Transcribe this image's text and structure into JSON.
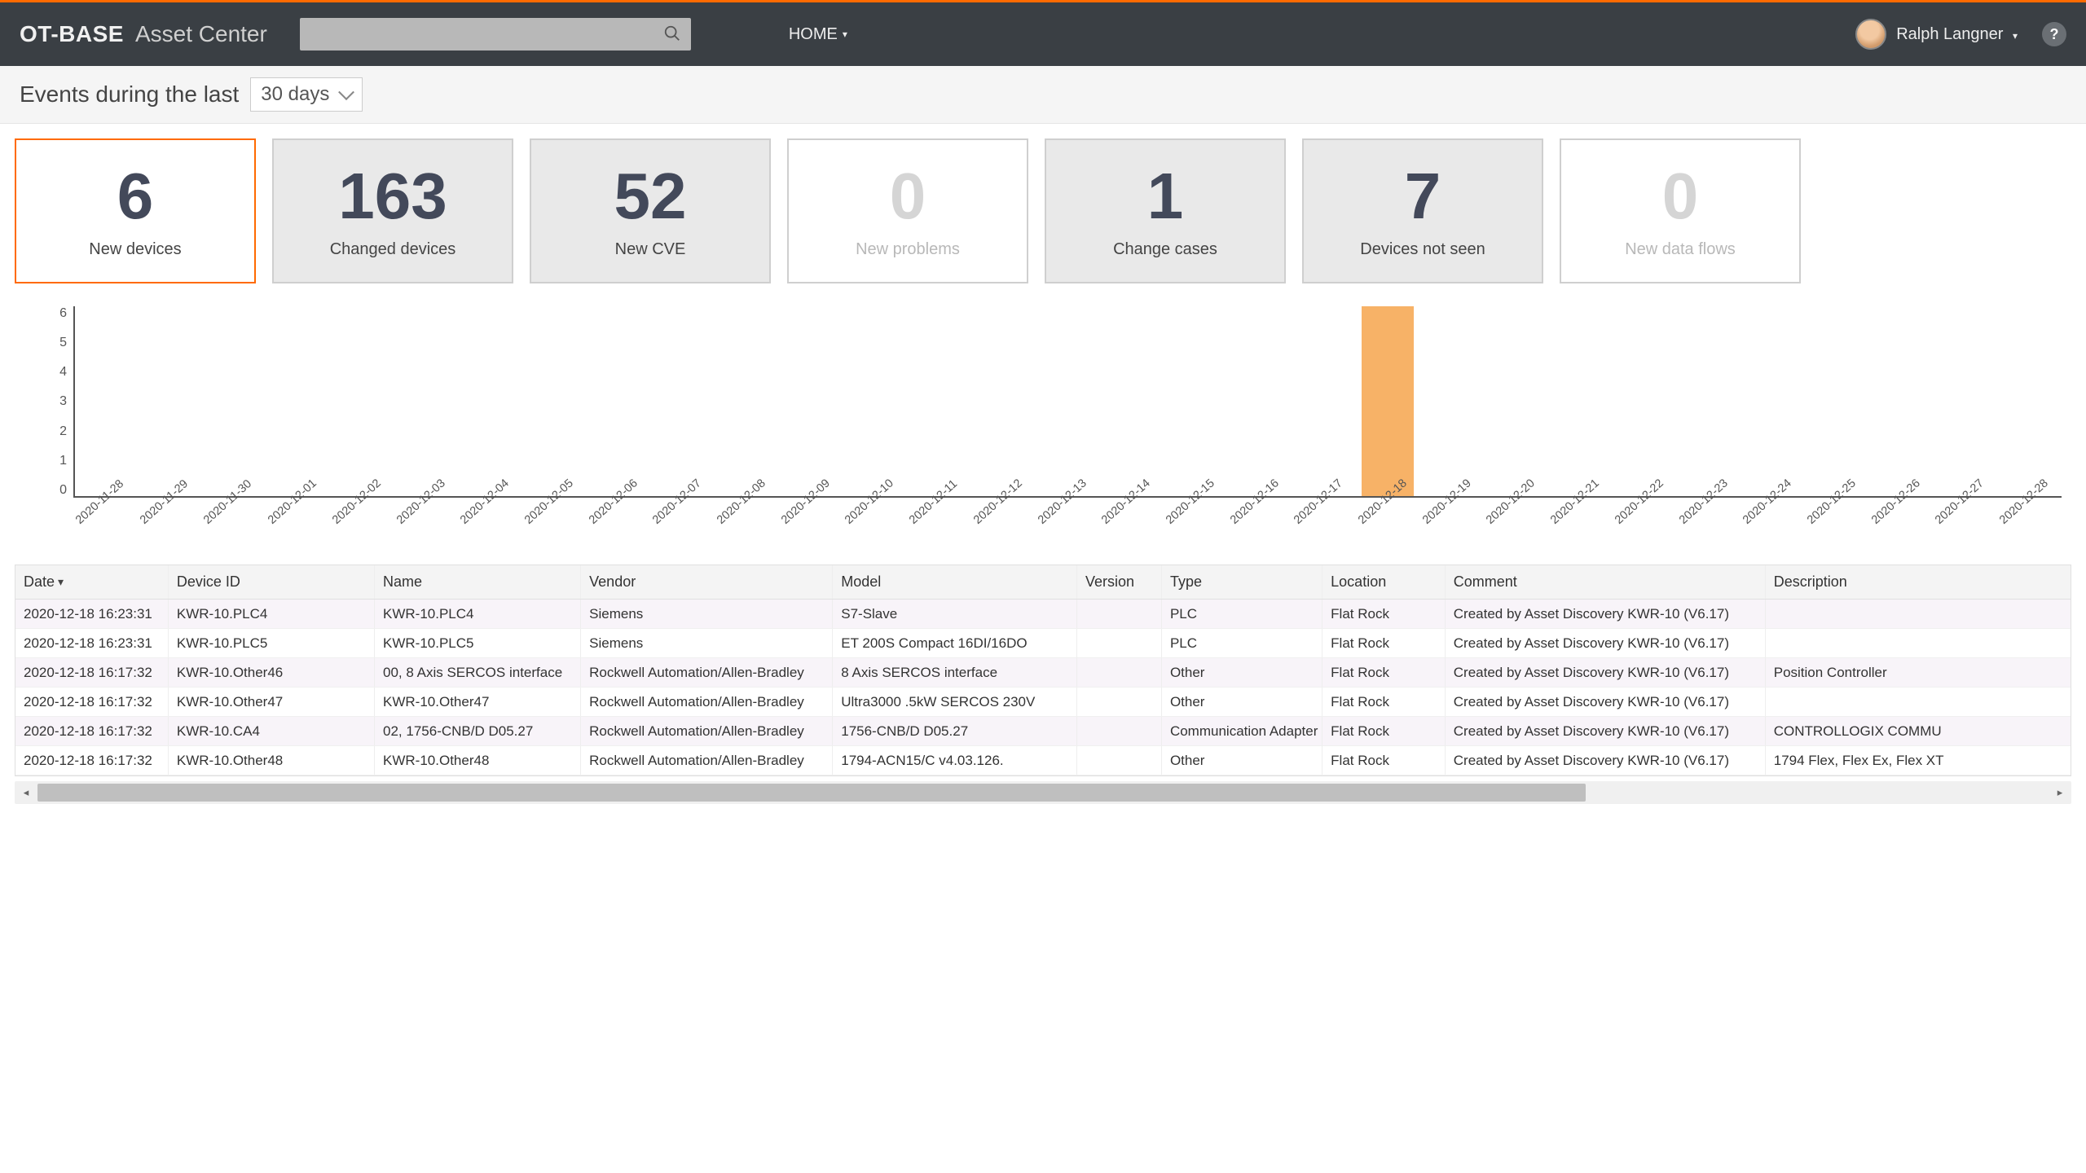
{
  "header": {
    "brand": "OT-BASE",
    "section": "Asset Center",
    "search_placeholder": "",
    "nav_home": "HOME",
    "user_name": "Ralph Langner"
  },
  "subheader": {
    "title": "Events during the last",
    "range_value": "30 days"
  },
  "tiles": [
    {
      "value": "6",
      "label": "New devices",
      "state": "active"
    },
    {
      "value": "163",
      "label": "Changed devices",
      "state": "normal"
    },
    {
      "value": "52",
      "label": "New CVE",
      "state": "normal"
    },
    {
      "value": "0",
      "label": "New problems",
      "state": "inactive"
    },
    {
      "value": "1",
      "label": "Change cases",
      "state": "normal"
    },
    {
      "value": "7",
      "label": "Devices not seen",
      "state": "normal"
    },
    {
      "value": "0",
      "label": "New data flows",
      "state": "inactive"
    }
  ],
  "chart_data": {
    "type": "bar",
    "title": "",
    "xlabel": "",
    "ylabel": "",
    "ylim": [
      0,
      6
    ],
    "yticks": [
      0,
      1,
      2,
      3,
      4,
      5,
      6
    ],
    "categories": [
      "2020-11-28",
      "2020-11-29",
      "2020-11-30",
      "2020-12-01",
      "2020-12-02",
      "2020-12-03",
      "2020-12-04",
      "2020-12-05",
      "2020-12-06",
      "2020-12-07",
      "2020-12-08",
      "2020-12-09",
      "2020-12-10",
      "2020-12-11",
      "2020-12-12",
      "2020-12-13",
      "2020-12-14",
      "2020-12-15",
      "2020-12-16",
      "2020-12-17",
      "2020-12-18",
      "2020-12-19",
      "2020-12-20",
      "2020-12-21",
      "2020-12-22",
      "2020-12-23",
      "2020-12-24",
      "2020-12-25",
      "2020-12-26",
      "2020-12-27",
      "2020-12-28"
    ],
    "values": [
      0,
      0,
      0,
      0,
      0,
      0,
      0,
      0,
      0,
      0,
      0,
      0,
      0,
      0,
      0,
      0,
      0,
      0,
      0,
      0,
      6,
      0,
      0,
      0,
      0,
      0,
      0,
      0,
      0,
      0,
      0
    ]
  },
  "table": {
    "columns": [
      "Date",
      "Device ID",
      "Name",
      "Vendor",
      "Model",
      "Version",
      "Type",
      "Location",
      "Comment",
      "Description"
    ],
    "sort_col": 0,
    "rows": [
      {
        "date": "2020-12-18 16:23:31",
        "id": "KWR-10.PLC4",
        "name": "KWR-10.PLC4",
        "vendor": "Siemens",
        "model": "S7-Slave",
        "ver": "",
        "type": "PLC",
        "loc": "Flat Rock",
        "com": "Created by Asset Discovery KWR-10 (V6.17)",
        "desc": ""
      },
      {
        "date": "2020-12-18 16:23:31",
        "id": "KWR-10.PLC5",
        "name": "KWR-10.PLC5",
        "vendor": "Siemens",
        "model": "ET 200S Compact 16DI/16DO",
        "ver": "",
        "type": "PLC",
        "loc": "Flat Rock",
        "com": "Created by Asset Discovery KWR-10 (V6.17)",
        "desc": ""
      },
      {
        "date": "2020-12-18 16:17:32",
        "id": "KWR-10.Other46",
        "name": "00, 8 Axis SERCOS interface",
        "vendor": "Rockwell Automation/Allen-Bradley",
        "model": "8 Axis SERCOS interface",
        "ver": "",
        "type": "Other",
        "loc": "Flat Rock",
        "com": "Created by Asset Discovery KWR-10 (V6.17)",
        "desc": "Position Controller"
      },
      {
        "date": "2020-12-18 16:17:32",
        "id": "KWR-10.Other47",
        "name": "KWR-10.Other47",
        "vendor": "Rockwell Automation/Allen-Bradley",
        "model": "Ultra3000 .5kW SERCOS 230V",
        "ver": "",
        "type": "Other",
        "loc": "Flat Rock",
        "com": "Created by Asset Discovery KWR-10 (V6.17)",
        "desc": ""
      },
      {
        "date": "2020-12-18 16:17:32",
        "id": "KWR-10.CA4",
        "name": "02, 1756-CNB/D D05.27",
        "vendor": "Rockwell Automation/Allen-Bradley",
        "model": "1756-CNB/D D05.27",
        "ver": "",
        "type": "Communication Adapter",
        "loc": "Flat Rock",
        "com": "Created by Asset Discovery KWR-10 (V6.17)",
        "desc": "CONTROLLOGIX COMMU"
      },
      {
        "date": "2020-12-18 16:17:32",
        "id": "KWR-10.Other48",
        "name": "KWR-10.Other48",
        "vendor": "Rockwell Automation/Allen-Bradley",
        "model": "1794-ACN15/C v4.03.126.",
        "ver": "",
        "type": "Other",
        "loc": "Flat Rock",
        "com": "Created by Asset Discovery KWR-10 (V6.17)",
        "desc": "1794 Flex, Flex Ex, Flex XT"
      }
    ]
  }
}
